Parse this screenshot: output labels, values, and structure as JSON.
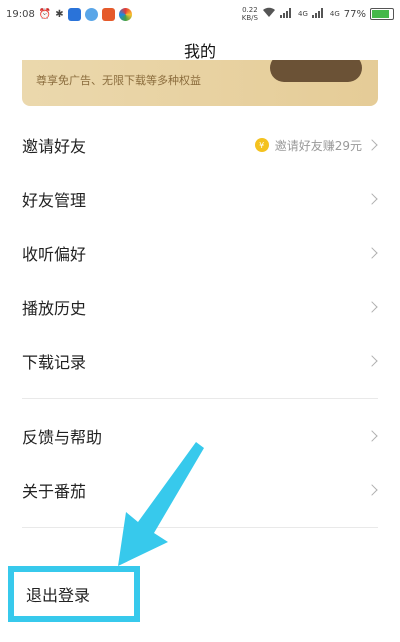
{
  "status": {
    "time": "19:08",
    "speed_value": "0.22",
    "speed_unit": "KB/S",
    "signal1": "4G",
    "signal2": "4G",
    "battery": "77%"
  },
  "header": {
    "title": "我的"
  },
  "vip": {
    "text": "尊享免广告、无限下载等多种权益",
    "button_label": ""
  },
  "menu": {
    "invite": {
      "label": "邀请好友",
      "hint": "邀请好友赚29元"
    },
    "friends": {
      "label": "好友管理"
    },
    "listen": {
      "label": "收听偏好"
    },
    "history": {
      "label": "播放历史"
    },
    "downloads": {
      "label": "下载记录"
    },
    "feedback": {
      "label": "反馈与帮助"
    },
    "about": {
      "label": "关于番茄"
    }
  },
  "logout": {
    "label": "退出登录"
  },
  "colors": {
    "highlight": "#37c9ec",
    "vip_gradient_start": "#ebd8ad",
    "vip_gradient_end": "#e5cc97"
  }
}
